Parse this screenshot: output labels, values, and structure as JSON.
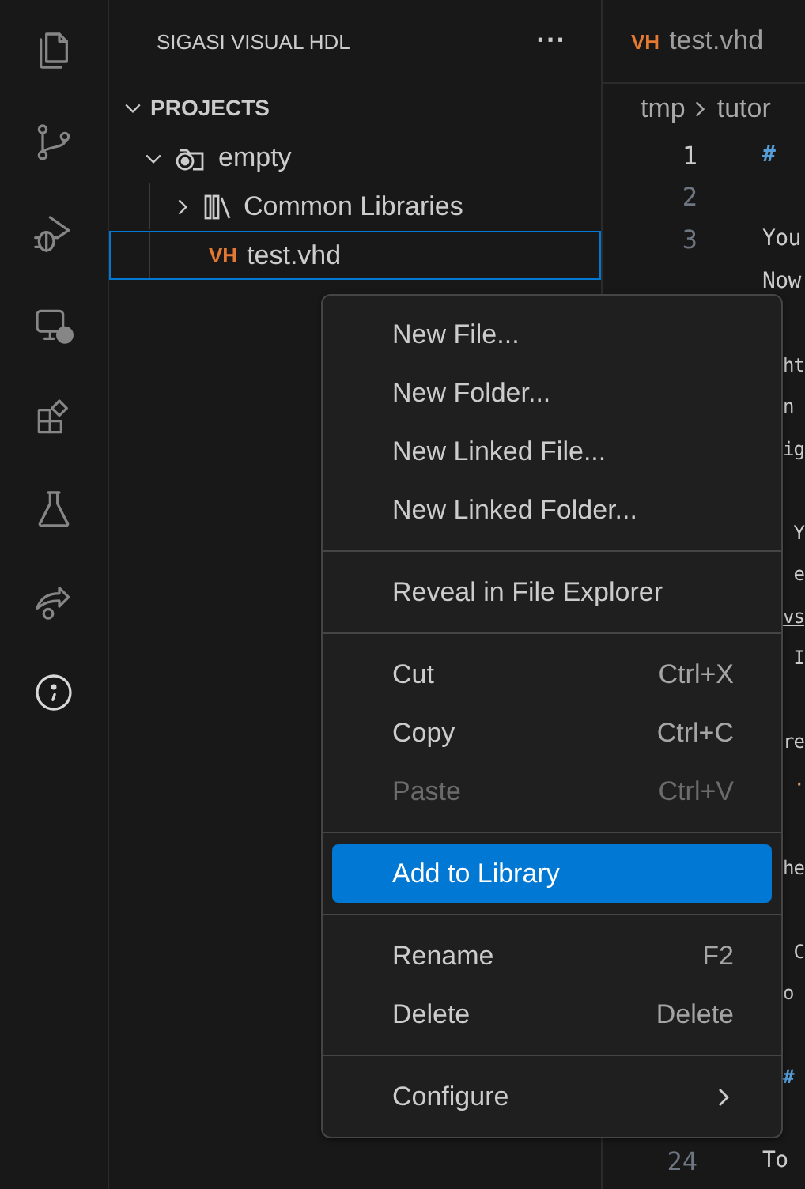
{
  "activity_bar": [
    {
      "selected": false
    },
    {
      "selected": false
    },
    {
      "selected": false
    },
    {
      "selected": false
    },
    {
      "selected": false
    },
    {
      "selected": false
    },
    {
      "selected": false
    },
    {
      "selected": true
    }
  ],
  "sidebar": {
    "title": "SIGASI VISUAL HDL",
    "more": "···",
    "section": {
      "title": "PROJECTS",
      "expanded": true
    },
    "tree": [
      {
        "label": "empty",
        "kind": "project",
        "expanded": true,
        "selected": false,
        "children": [
          {
            "label": "Common Libraries",
            "kind": "library",
            "expanded": false,
            "selected": false
          },
          {
            "label": "test.vhd",
            "badge": "VH",
            "kind": "file",
            "selected": true
          }
        ]
      }
    ]
  },
  "editor": {
    "tab": {
      "badge": "VH",
      "label": "test.vhd"
    },
    "breadcrumb": [
      "tmp",
      "tutor"
    ],
    "lines": [
      {
        "number": "1",
        "text": "#",
        "kind": "heading",
        "current": true
      },
      {
        "number": "2"
      },
      {
        "number": "3",
        "text": "You"
      },
      {
        "text": "Now"
      },
      {
        "text": "ht",
        "gap_before": true
      },
      {
        "text": "n"
      },
      {
        "text": "ig"
      },
      {
        "text": " Y",
        "gap_before": true
      },
      {
        "text": " e"
      },
      {
        "text": "vs",
        "kind": "link"
      },
      {
        "text": " I"
      },
      {
        "text": "re",
        "gap_before": true
      },
      {
        "text": " ·",
        "kind": "bullet"
      },
      {
        "text": "he",
        "gap_before": true
      },
      {
        "text": " C",
        "gap_before": true
      },
      {
        "text": "o"
      },
      {
        "text": "#",
        "kind": "heading",
        "gap_before": true
      },
      {
        "number": "24",
        "text": "To",
        "gap_before": true
      }
    ]
  },
  "context_menu": [
    {
      "kind": "item",
      "label": "New File...",
      "disabled": false,
      "selected": false
    },
    {
      "kind": "item",
      "label": "New Folder...",
      "disabled": false,
      "selected": false
    },
    {
      "kind": "item",
      "label": "New Linked File...",
      "disabled": false,
      "selected": false
    },
    {
      "kind": "item",
      "label": "New Linked Folder...",
      "disabled": false,
      "selected": false
    },
    {
      "kind": "separator"
    },
    {
      "kind": "item",
      "label": "Reveal in File Explorer",
      "disabled": false,
      "selected": false
    },
    {
      "kind": "separator"
    },
    {
      "kind": "item",
      "label": "Cut",
      "shortcut": "Ctrl+X",
      "disabled": false,
      "selected": false
    },
    {
      "kind": "item",
      "label": "Copy",
      "shortcut": "Ctrl+C",
      "disabled": false,
      "selected": false
    },
    {
      "kind": "item",
      "label": "Paste",
      "shortcut": "Ctrl+V",
      "disabled": true,
      "selected": false
    },
    {
      "kind": "separator"
    },
    {
      "kind": "item",
      "label": "Add to Library",
      "disabled": false,
      "selected": true
    },
    {
      "kind": "separator"
    },
    {
      "kind": "item",
      "label": "Rename",
      "shortcut": "F2",
      "disabled": false,
      "selected": false
    },
    {
      "kind": "item",
      "label": "Delete",
      "shortcut": "Delete",
      "disabled": false,
      "selected": false
    },
    {
      "kind": "separator"
    },
    {
      "kind": "submenu",
      "label": "Configure",
      "disabled": false,
      "selected": false
    }
  ]
}
